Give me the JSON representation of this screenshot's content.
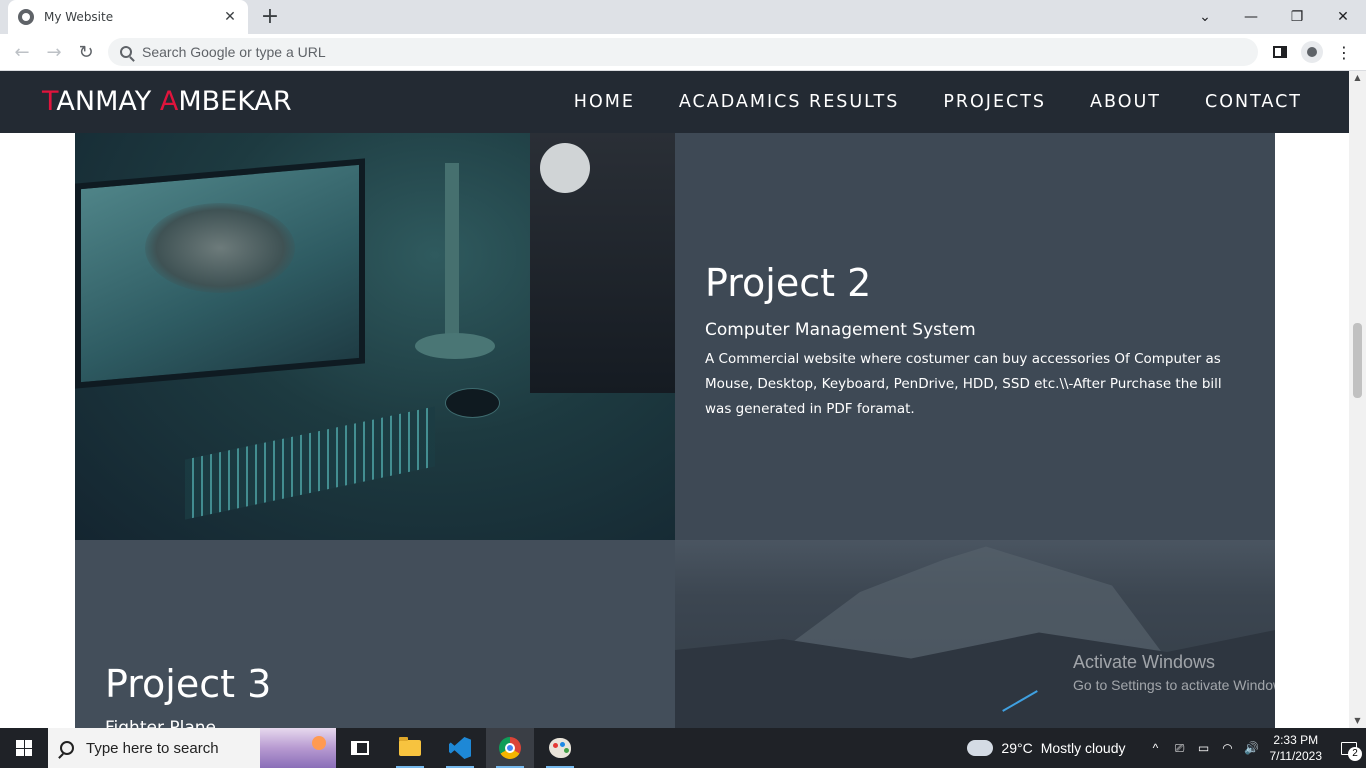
{
  "browser": {
    "tab_title": "My Website",
    "tab_close": "✕",
    "new_tab": "+",
    "omnibox_placeholder": "Search Google or type a URL",
    "back": "←",
    "forward": "→",
    "reload": "↻",
    "window_controls": {
      "tab_search": "⌄",
      "minimize": "—",
      "maximize": "❐",
      "close": "✕"
    },
    "toolbar_menu": "⋮"
  },
  "site": {
    "logo": {
      "first_initial": "T",
      "first_rest": "ANMAY ",
      "last_initial": "A",
      "last_rest": "MBEKAR"
    },
    "accent_color": "#e0143c",
    "nav": [
      "HOME",
      "ACADAMICS RESULTS",
      "PROJECTS",
      "ABOUT",
      "CONTACT"
    ],
    "projects": [
      {
        "title": "Project 2",
        "subtitle": "Computer Management System",
        "description": "A Commercial website where costumer can buy accessories Of Computer as Mouse, Desktop, Keyboard, PenDrive, HDD, SSD etc.\\\\-After Purchase the bill was generated in PDF foramat."
      },
      {
        "title": "Project 3",
        "subtitle": "Fighter Plane"
      }
    ]
  },
  "watermark": {
    "line1": "Activate Windows",
    "line2": "Go to Settings to activate Windows."
  },
  "taskbar": {
    "search_placeholder": "Type here to search",
    "apps": [
      "task-view",
      "file-explorer",
      "vscode",
      "chrome",
      "paint"
    ],
    "weather": {
      "temp": "29°C",
      "condition": "Mostly cloudy"
    },
    "tray_icons": [
      "^",
      "⎚",
      "▭",
      "◠",
      "🔊"
    ],
    "time": "2:33 PM",
    "date": "7/11/2023",
    "notification_count": "2"
  }
}
